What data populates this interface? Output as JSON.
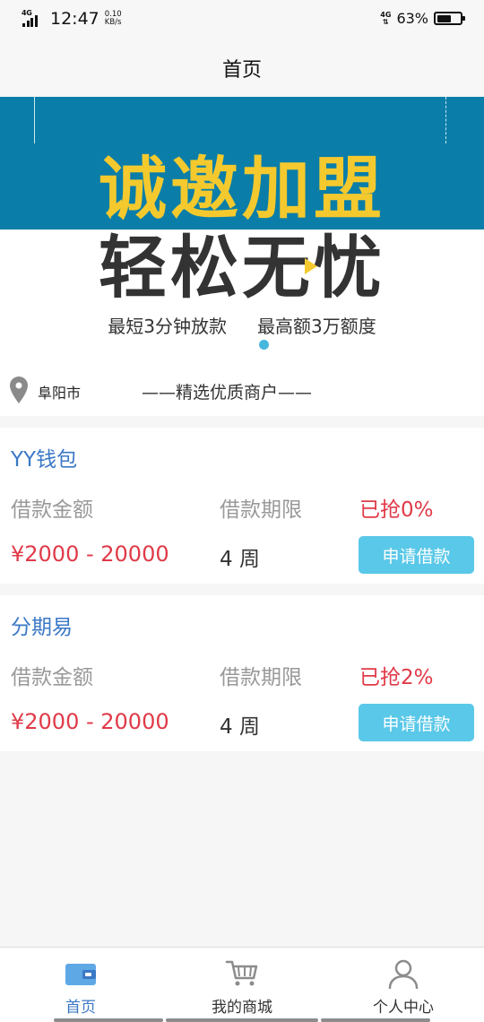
{
  "status_bar": {
    "network": "4G",
    "time": "12:47",
    "speed_value": "0.10",
    "speed_unit": "KB/s",
    "network_right": "4G",
    "battery_percent": "63%",
    "battery_level": 0.63
  },
  "nav": {
    "title": "首页"
  },
  "banner": {
    "headline": "诚邀加盟",
    "subheadline": "轻松无忧",
    "tagline_left": "最短3分钟放款",
    "tagline_right": "最高额3万额度",
    "colors": {
      "blue": "#0a7ea8",
      "yellow": "#f4c92e",
      "dot": "#47b7de"
    }
  },
  "location": {
    "city": "阜阳市",
    "section_title": "——精选优质商户——"
  },
  "products": [
    {
      "name": "YY钱包",
      "amount_label": "借款金额",
      "term_label": "借款期限",
      "grabbed": "已抢0%",
      "amount_range": "¥2000 - 20000",
      "term": "4 周",
      "apply_label": "申请借款"
    },
    {
      "name": "分期易",
      "amount_label": "借款金额",
      "term_label": "借款期限",
      "grabbed": "已抢2%",
      "amount_range": "¥2000 - 20000",
      "term": "4 周",
      "apply_label": "申请借款"
    }
  ],
  "tab_bar": {
    "tabs": [
      {
        "label": "首页",
        "icon": "wallet-icon",
        "active": true
      },
      {
        "label": "我的商城",
        "icon": "cart-icon",
        "active": false
      },
      {
        "label": "个人中心",
        "icon": "person-icon",
        "active": false
      }
    ],
    "active_color": "#3b78c6"
  }
}
